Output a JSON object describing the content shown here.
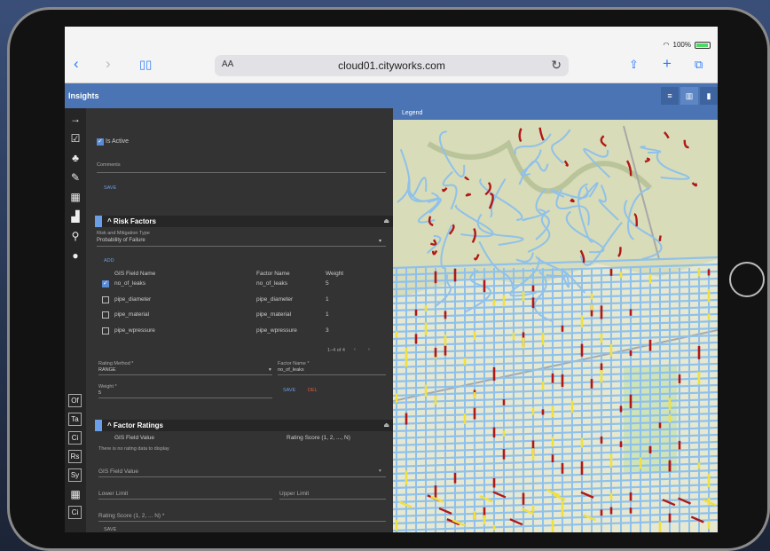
{
  "status": {
    "wifi": "wifi-icon",
    "battery_text": "100%"
  },
  "safari": {
    "reader_label": "AA",
    "url": "cloud01.cityworks.com"
  },
  "app": {
    "title": "Insights"
  },
  "panel": {
    "is_active_label": "Is Active",
    "comments_label": "Comments",
    "save_label": "SAVE",
    "risk_factors": {
      "title": "Risk Factors",
      "mitigation_type_label": "Risk and Mitigation Type",
      "mitigation_type_value": "Probability of Failure",
      "add_label": "ADD",
      "columns": [
        "GIS Field Name",
        "Factor Name",
        "Weight"
      ],
      "rows": [
        {
          "field": "no_of_leaks",
          "factor": "no_of_leaks",
          "weight": "5",
          "checked": true
        },
        {
          "field": "pipe_diameter",
          "factor": "pipe_diameter",
          "weight": "1",
          "checked": false
        },
        {
          "field": "pipe_material",
          "factor": "pipe_material",
          "weight": "1",
          "checked": false
        },
        {
          "field": "pipe_wpressure",
          "factor": "pipe_wpressure",
          "weight": "3",
          "checked": false
        }
      ],
      "pagination": "1–4 of 4",
      "rating_method_label": "Rating Method *",
      "rating_method_value": "RANGE",
      "factor_name_label": "Factor Name *",
      "factor_name_value": "no_of_leaks",
      "weight_label": "Weight *",
      "weight_value": "5",
      "save_label": "SAVE",
      "cancel_label": "DEL"
    },
    "factor_ratings": {
      "title": "Factor Ratings",
      "columns": [
        "GIS Field Value",
        "Rating Score (1, 2, ..., N)"
      ],
      "empty_text": "There is no rating data to display",
      "gis_field_value_label": "GIS Field Value",
      "lower_limit_label": "Lower Limit",
      "upper_limit_label": "Upper Limit",
      "rating_score_label": "Rating Score (1, 2, ... N) *",
      "save_label": "SAVE"
    }
  },
  "sidebar_text_items": [
    "Of",
    "Ta",
    "Ci",
    "Rs",
    "Sy",
    "Ci"
  ],
  "map": {
    "legend_label": "Legend"
  },
  "colors": {
    "header": "#4a74b4",
    "accent": "#6a9ee6",
    "pipe": "#8fc1ea",
    "risk_high": "#b01818",
    "risk_mid": "#f0e040"
  }
}
